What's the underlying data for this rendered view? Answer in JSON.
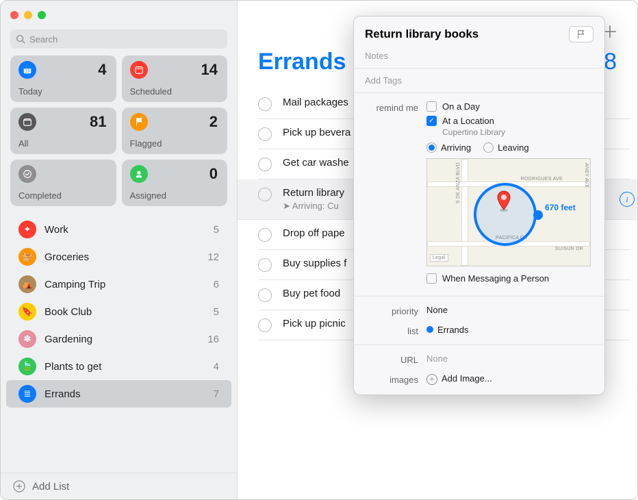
{
  "search": {
    "placeholder": "Search"
  },
  "smartLists": [
    {
      "label": "Today",
      "count": 4,
      "color": "c-blue"
    },
    {
      "label": "Scheduled",
      "count": 14,
      "color": "c-red"
    },
    {
      "label": "All",
      "count": 81,
      "color": "c-dark"
    },
    {
      "label": "Flagged",
      "count": 2,
      "color": "c-orange"
    },
    {
      "label": "Completed",
      "count": "",
      "color": "c-gray"
    },
    {
      "label": "Assigned",
      "count": 0,
      "color": "c-green"
    }
  ],
  "lists": [
    {
      "name": "Work",
      "count": 5,
      "color": "#ff3b30",
      "icon": "✦"
    },
    {
      "name": "Groceries",
      "count": 12,
      "color": "#ff9500",
      "icon": "🧺"
    },
    {
      "name": "Camping Trip",
      "count": 6,
      "color": "#af8a5b",
      "icon": "⛺"
    },
    {
      "name": "Book Club",
      "count": 5,
      "color": "#ffcc00",
      "icon": "🔖"
    },
    {
      "name": "Gardening",
      "count": 16,
      "color": "#e58fa0",
      "icon": "✽"
    },
    {
      "name": "Plants to get",
      "count": 4,
      "color": "#34c759",
      "icon": "🍃"
    },
    {
      "name": "Errands",
      "count": 7,
      "color": "#0a7aff",
      "icon": "≣",
      "selected": true
    }
  ],
  "addList": "Add List",
  "main": {
    "title": "Errands",
    "count": 8
  },
  "reminders": [
    {
      "title": "Mail packages"
    },
    {
      "title": "Pick up bevera"
    },
    {
      "title": "Get car washe"
    },
    {
      "title": "Return library",
      "sub": "Arriving: Cu",
      "selected": true
    },
    {
      "title": "Drop off pape"
    },
    {
      "title": "Buy supplies f"
    },
    {
      "title": "Buy pet food"
    },
    {
      "title": "Pick up picnic"
    }
  ],
  "popover": {
    "title": "Return library books",
    "notesPlaceholder": "Notes",
    "tagsPlaceholder": "Add Tags",
    "remindMeLabel": "remind me",
    "onADay": {
      "label": "On a Day",
      "checked": false
    },
    "atLocation": {
      "label": "At a Location",
      "checked": true,
      "detail": "Cupertino Library"
    },
    "arrivingLabel": "Arriving",
    "leavingLabel": "Leaving",
    "arrivingSelected": true,
    "geofenceDistance": "670 feet",
    "whenMessaging": {
      "label": "When Messaging a Person",
      "checked": false
    },
    "priorityLabel": "priority",
    "priorityValue": "None",
    "listLabel": "list",
    "listValue": "Errands",
    "urlLabel": "URL",
    "urlValue": "None",
    "imagesLabel": "images",
    "imagesValue": "Add Image...",
    "mapStreets": {
      "anza": "S DE ANZA BLVD",
      "rodrigues": "RODRIGUES AVE",
      "pacifica": "PACIFICA DR",
      "suisun": "SUISUN DR",
      "aney": "ANEY AVE",
      "legal": "Legal"
    }
  }
}
